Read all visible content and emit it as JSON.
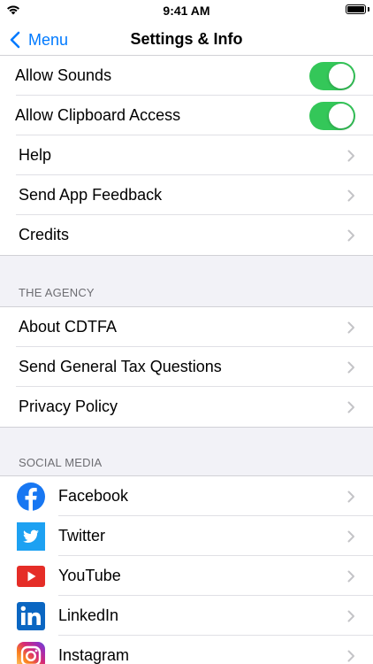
{
  "status_bar": {
    "time": "9:41 AM"
  },
  "nav": {
    "back_label": "Menu",
    "title": "Settings & Info"
  },
  "toggles": [
    {
      "label": "Allow Sounds",
      "on": true
    },
    {
      "label": "Allow Clipboard Access",
      "on": true
    }
  ],
  "general": [
    {
      "label": "Help"
    },
    {
      "label": "Send App Feedback"
    },
    {
      "label": "Credits"
    }
  ],
  "agency": {
    "header": "THE AGENCY",
    "items": [
      {
        "label": "About CDTFA"
      },
      {
        "label": "Send General Tax Questions"
      },
      {
        "label": "Privacy Policy"
      }
    ]
  },
  "social": {
    "header": "SOCIAL MEDIA",
    "items": [
      {
        "label": "Facebook",
        "icon": "facebook-icon",
        "color": "#1877f2"
      },
      {
        "label": "Twitter",
        "icon": "twitter-icon",
        "color": "#1da1f2"
      },
      {
        "label": "YouTube",
        "icon": "youtube-icon",
        "color": "#e52d27"
      },
      {
        "label": "LinkedIn",
        "icon": "linkedin-icon",
        "color": "#0a66c2"
      },
      {
        "label": "Instagram",
        "icon": "instagram-icon",
        "color": "#d62976"
      }
    ]
  },
  "colors": {
    "accent": "#007aff",
    "toggle_on": "#34c759",
    "background": "#f2f2f7"
  }
}
